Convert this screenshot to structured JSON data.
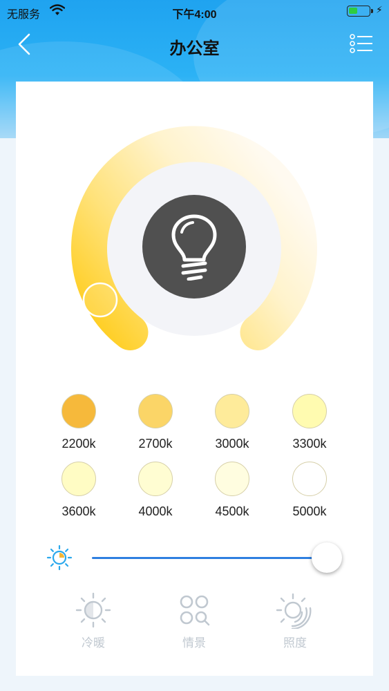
{
  "status_bar": {
    "carrier": "无服务",
    "time": "下午4:00",
    "battery_level": 0.45
  },
  "nav": {
    "title": "办公室"
  },
  "dial": {
    "selected_temperature": "2200k"
  },
  "swatches": [
    {
      "label": "2200k",
      "color": "#f6b93b"
    },
    {
      "label": "2700k",
      "color": "#fbd567"
    },
    {
      "label": "3000k",
      "color": "#feeb9a"
    },
    {
      "label": "3300k",
      "color": "#fffbb0"
    },
    {
      "label": "3600k",
      "color": "#fffcc4"
    },
    {
      "label": "4000k",
      "color": "#fffdd2"
    },
    {
      "label": "4500k",
      "color": "#fffde0"
    },
    {
      "label": "5000k",
      "color": "#ffffff"
    }
  ],
  "brightness": {
    "value": 1.0
  },
  "tabs": [
    {
      "label": "冷暖",
      "icon": "sun-half-icon"
    },
    {
      "label": "情景",
      "icon": "scene-icon"
    },
    {
      "label": "照度",
      "icon": "illuminance-icon"
    }
  ],
  "colors": {
    "accent_blue": "#2e7fe0",
    "header_blue": "#1fa3f0",
    "bulb_bg": "#505050",
    "tab_inactive": "#c0c8d0"
  }
}
